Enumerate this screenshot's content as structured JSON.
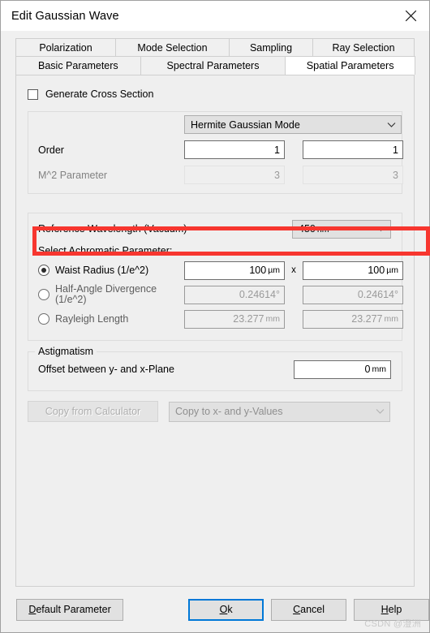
{
  "window": {
    "title": "Edit Gaussian Wave",
    "close_icon": "close-icon"
  },
  "tabs": {
    "row1": [
      {
        "label": "Polarization",
        "selected": false
      },
      {
        "label": "Mode Selection",
        "selected": false
      },
      {
        "label": "Sampling",
        "selected": false
      },
      {
        "label": "Ray Selection",
        "selected": false
      }
    ],
    "row2": [
      {
        "label": "Basic Parameters",
        "selected": false
      },
      {
        "label": "Spectral Parameters",
        "selected": false
      },
      {
        "label": "Spatial Parameters",
        "selected": true
      }
    ]
  },
  "spatial": {
    "generate_cross_section": {
      "label": "Generate Cross Section",
      "checked": false
    },
    "mode_combo": {
      "value": "Hermite Gaussian Mode",
      "chevron": "chevron-down-icon"
    },
    "order": {
      "label": "Order",
      "x_value": "1",
      "y_value": "1",
      "enabled": true
    },
    "m2_parameter": {
      "label": "M^2 Parameter",
      "x_value": "3",
      "y_value": "3",
      "enabled": false
    },
    "reference_wavelength": {
      "label": "Reference Wavelength (Vacuum)",
      "value": "450",
      "unit": "nm",
      "chevron": "chevron-down-icon"
    },
    "achromatic": {
      "heading": "Select Achromatic Parameter:",
      "options": [
        {
          "label": "Waist Radius (1/e^2)",
          "selected": true,
          "enabled": true,
          "x_value": "100",
          "x_unit": "µm",
          "y_value": "100",
          "y_unit": "µm",
          "separator": "x"
        },
        {
          "label": "Half-Angle Divergence (1/e^2)",
          "label_line1": "Half-Angle  Divergence",
          "label_line2": "(1/e^2)",
          "selected": false,
          "enabled": false,
          "x_value": "0.24614°",
          "x_unit": "",
          "y_value": "0.24614°",
          "y_unit": "",
          "separator": ""
        },
        {
          "label": "Rayleigh Length",
          "label_line1": "Rayleigh Length",
          "label_line2": "",
          "selected": false,
          "enabled": false,
          "x_value": "23.277",
          "x_unit": "mm",
          "y_value": "23.277",
          "y_unit": "mm",
          "separator": ""
        }
      ]
    },
    "astigmatism": {
      "legend": "Astigmatism",
      "offset_label": "Offset between y- and x-Plane",
      "offset_value": "0",
      "offset_unit": "mm"
    },
    "copy_from_calculator": {
      "label": "Copy from Calculator",
      "enabled": false
    },
    "copy_to_values": {
      "label": "Copy to x- and y-Values",
      "enabled": false,
      "chevron": "chevron-down-icon"
    }
  },
  "footer": {
    "default_parameter": {
      "pre": "",
      "acc": "D",
      "post": "efault Parameter"
    },
    "ok": {
      "pre": "",
      "acc": "O",
      "post": "k"
    },
    "cancel": {
      "pre": "",
      "acc": "C",
      "post": "ancel"
    },
    "help": {
      "pre": "",
      "acc": "H",
      "post": "elp"
    }
  },
  "watermark": {
    "text": "CSDN @澄洲"
  },
  "annotation": {
    "highlight_color": "#f7362f",
    "target": "order-row"
  },
  "colors": {
    "accent_focus": "#0078d7",
    "dialog_bg": "#f0f0f0",
    "page_bg": "#efefef",
    "field_bg": "#ffffff",
    "control_bg": "#e1e1e1",
    "disabled_text": "#9a9a9a",
    "highlight": "#f7362f"
  }
}
